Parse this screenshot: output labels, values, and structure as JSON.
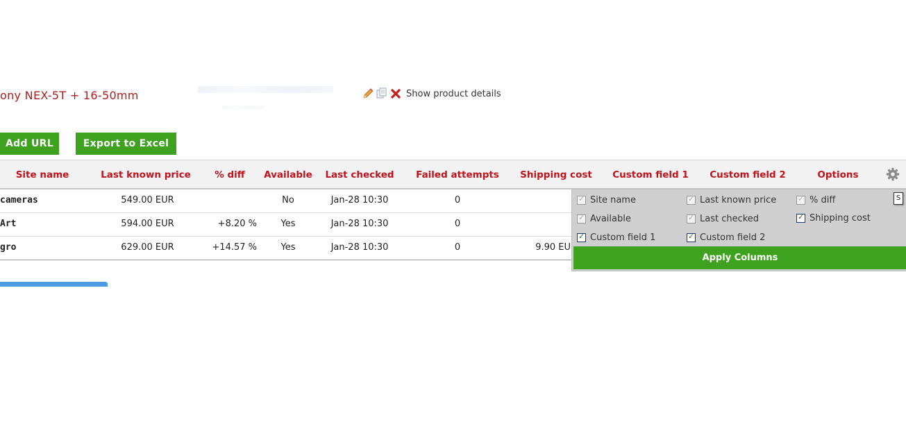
{
  "product": {
    "title": "ony NEX-5T + 16-50mm",
    "show_details": "Show product details"
  },
  "toolbar": {
    "add_url": "Add URL",
    "export_excel": "Export to Excel"
  },
  "table": {
    "columns": [
      "Site name",
      "Last known price",
      "% diff",
      "Available",
      "Last checked",
      "Failed attempts",
      "Shipping cost",
      "Custom field 1",
      "Custom field 2",
      "Options"
    ],
    "rows": [
      {
        "site": "cameras",
        "price": "549.00 EUR",
        "diff": "",
        "available": "No",
        "checked": "Jan-28 10:30",
        "failed": "0",
        "shipping": ""
      },
      {
        "site": "Art",
        "price": "594.00 EUR",
        "diff": "+8.20 %",
        "available": "Yes",
        "checked": "Jan-28 10:30",
        "failed": "0",
        "shipping": ""
      },
      {
        "site": "gro",
        "price": "629.00 EUR",
        "diff": "+14.57 %",
        "available": "Yes",
        "checked": "Jan-28 10:30",
        "failed": "0",
        "shipping": "9.90 EU"
      }
    ]
  },
  "columns_panel": {
    "options": [
      {
        "label": "Site name",
        "checked": true,
        "disabled": true
      },
      {
        "label": "Last known price",
        "checked": true,
        "disabled": true
      },
      {
        "label": "% diff",
        "checked": true,
        "disabled": true
      },
      {
        "label": "Available",
        "checked": true,
        "disabled": true
      },
      {
        "label": "Last checked",
        "checked": true,
        "disabled": true
      },
      {
        "label": "Shipping cost",
        "checked": true,
        "disabled": false
      },
      {
        "label": "Custom field 1",
        "checked": true,
        "disabled": false
      },
      {
        "label": "Custom field 2",
        "checked": true,
        "disabled": false
      }
    ],
    "apply_label": "Apply Columns",
    "tooltip": "S"
  },
  "colors": {
    "accent_red": "#c0141c",
    "button_green": "#3fa21f",
    "progress_blue": "#4d9be4"
  },
  "icons": [
    "pencil-icon",
    "copy-icon",
    "delete-icon",
    "gear-icon"
  ]
}
